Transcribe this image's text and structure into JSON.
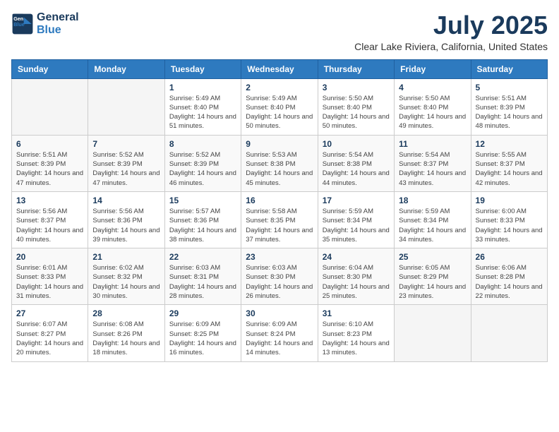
{
  "header": {
    "logo_line1": "General",
    "logo_line2": "Blue",
    "month": "July 2025",
    "location": "Clear Lake Riviera, California, United States"
  },
  "weekdays": [
    "Sunday",
    "Monday",
    "Tuesday",
    "Wednesday",
    "Thursday",
    "Friday",
    "Saturday"
  ],
  "weeks": [
    [
      {
        "day": "",
        "empty": true
      },
      {
        "day": "",
        "empty": true
      },
      {
        "day": "1",
        "sunrise": "Sunrise: 5:49 AM",
        "sunset": "Sunset: 8:40 PM",
        "daylight": "Daylight: 14 hours and 51 minutes."
      },
      {
        "day": "2",
        "sunrise": "Sunrise: 5:49 AM",
        "sunset": "Sunset: 8:40 PM",
        "daylight": "Daylight: 14 hours and 50 minutes."
      },
      {
        "day": "3",
        "sunrise": "Sunrise: 5:50 AM",
        "sunset": "Sunset: 8:40 PM",
        "daylight": "Daylight: 14 hours and 50 minutes."
      },
      {
        "day": "4",
        "sunrise": "Sunrise: 5:50 AM",
        "sunset": "Sunset: 8:40 PM",
        "daylight": "Daylight: 14 hours and 49 minutes."
      },
      {
        "day": "5",
        "sunrise": "Sunrise: 5:51 AM",
        "sunset": "Sunset: 8:39 PM",
        "daylight": "Daylight: 14 hours and 48 minutes."
      }
    ],
    [
      {
        "day": "6",
        "sunrise": "Sunrise: 5:51 AM",
        "sunset": "Sunset: 8:39 PM",
        "daylight": "Daylight: 14 hours and 47 minutes."
      },
      {
        "day": "7",
        "sunrise": "Sunrise: 5:52 AM",
        "sunset": "Sunset: 8:39 PM",
        "daylight": "Daylight: 14 hours and 47 minutes."
      },
      {
        "day": "8",
        "sunrise": "Sunrise: 5:52 AM",
        "sunset": "Sunset: 8:39 PM",
        "daylight": "Daylight: 14 hours and 46 minutes."
      },
      {
        "day": "9",
        "sunrise": "Sunrise: 5:53 AM",
        "sunset": "Sunset: 8:38 PM",
        "daylight": "Daylight: 14 hours and 45 minutes."
      },
      {
        "day": "10",
        "sunrise": "Sunrise: 5:54 AM",
        "sunset": "Sunset: 8:38 PM",
        "daylight": "Daylight: 14 hours and 44 minutes."
      },
      {
        "day": "11",
        "sunrise": "Sunrise: 5:54 AM",
        "sunset": "Sunset: 8:37 PM",
        "daylight": "Daylight: 14 hours and 43 minutes."
      },
      {
        "day": "12",
        "sunrise": "Sunrise: 5:55 AM",
        "sunset": "Sunset: 8:37 PM",
        "daylight": "Daylight: 14 hours and 42 minutes."
      }
    ],
    [
      {
        "day": "13",
        "sunrise": "Sunrise: 5:56 AM",
        "sunset": "Sunset: 8:37 PM",
        "daylight": "Daylight: 14 hours and 40 minutes."
      },
      {
        "day": "14",
        "sunrise": "Sunrise: 5:56 AM",
        "sunset": "Sunset: 8:36 PM",
        "daylight": "Daylight: 14 hours and 39 minutes."
      },
      {
        "day": "15",
        "sunrise": "Sunrise: 5:57 AM",
        "sunset": "Sunset: 8:36 PM",
        "daylight": "Daylight: 14 hours and 38 minutes."
      },
      {
        "day": "16",
        "sunrise": "Sunrise: 5:58 AM",
        "sunset": "Sunset: 8:35 PM",
        "daylight": "Daylight: 14 hours and 37 minutes."
      },
      {
        "day": "17",
        "sunrise": "Sunrise: 5:59 AM",
        "sunset": "Sunset: 8:34 PM",
        "daylight": "Daylight: 14 hours and 35 minutes."
      },
      {
        "day": "18",
        "sunrise": "Sunrise: 5:59 AM",
        "sunset": "Sunset: 8:34 PM",
        "daylight": "Daylight: 14 hours and 34 minutes."
      },
      {
        "day": "19",
        "sunrise": "Sunrise: 6:00 AM",
        "sunset": "Sunset: 8:33 PM",
        "daylight": "Daylight: 14 hours and 33 minutes."
      }
    ],
    [
      {
        "day": "20",
        "sunrise": "Sunrise: 6:01 AM",
        "sunset": "Sunset: 8:33 PM",
        "daylight": "Daylight: 14 hours and 31 minutes."
      },
      {
        "day": "21",
        "sunrise": "Sunrise: 6:02 AM",
        "sunset": "Sunset: 8:32 PM",
        "daylight": "Daylight: 14 hours and 30 minutes."
      },
      {
        "day": "22",
        "sunrise": "Sunrise: 6:03 AM",
        "sunset": "Sunset: 8:31 PM",
        "daylight": "Daylight: 14 hours and 28 minutes."
      },
      {
        "day": "23",
        "sunrise": "Sunrise: 6:03 AM",
        "sunset": "Sunset: 8:30 PM",
        "daylight": "Daylight: 14 hours and 26 minutes."
      },
      {
        "day": "24",
        "sunrise": "Sunrise: 6:04 AM",
        "sunset": "Sunset: 8:30 PM",
        "daylight": "Daylight: 14 hours and 25 minutes."
      },
      {
        "day": "25",
        "sunrise": "Sunrise: 6:05 AM",
        "sunset": "Sunset: 8:29 PM",
        "daylight": "Daylight: 14 hours and 23 minutes."
      },
      {
        "day": "26",
        "sunrise": "Sunrise: 6:06 AM",
        "sunset": "Sunset: 8:28 PM",
        "daylight": "Daylight: 14 hours and 22 minutes."
      }
    ],
    [
      {
        "day": "27",
        "sunrise": "Sunrise: 6:07 AM",
        "sunset": "Sunset: 8:27 PM",
        "daylight": "Daylight: 14 hours and 20 minutes."
      },
      {
        "day": "28",
        "sunrise": "Sunrise: 6:08 AM",
        "sunset": "Sunset: 8:26 PM",
        "daylight": "Daylight: 14 hours and 18 minutes."
      },
      {
        "day": "29",
        "sunrise": "Sunrise: 6:09 AM",
        "sunset": "Sunset: 8:25 PM",
        "daylight": "Daylight: 14 hours and 16 minutes."
      },
      {
        "day": "30",
        "sunrise": "Sunrise: 6:09 AM",
        "sunset": "Sunset: 8:24 PM",
        "daylight": "Daylight: 14 hours and 14 minutes."
      },
      {
        "day": "31",
        "sunrise": "Sunrise: 6:10 AM",
        "sunset": "Sunset: 8:23 PM",
        "daylight": "Daylight: 14 hours and 13 minutes."
      },
      {
        "day": "",
        "empty": true
      },
      {
        "day": "",
        "empty": true
      }
    ]
  ]
}
